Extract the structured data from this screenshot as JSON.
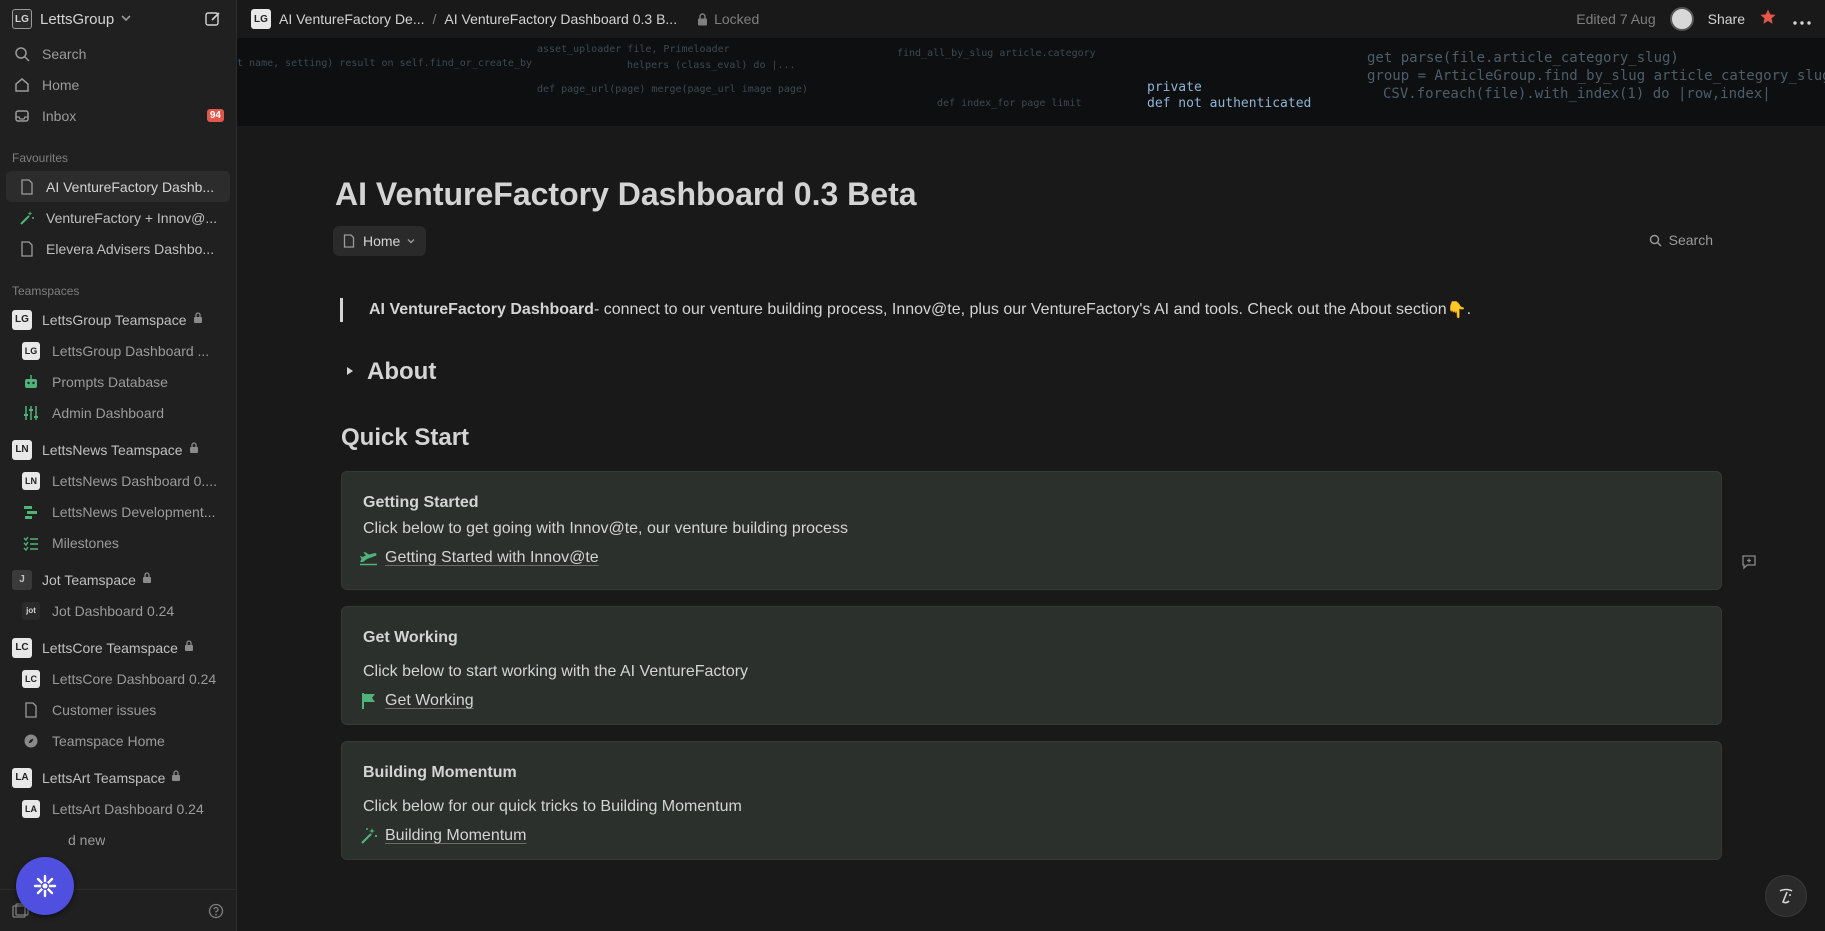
{
  "workspace": {
    "logo": "LG",
    "name": "LettsGroup"
  },
  "nav": {
    "search": "Search",
    "home": "Home",
    "inbox": "Inbox",
    "inbox_badge": "94"
  },
  "favourites": {
    "label": "Favourites",
    "items": [
      {
        "label": "AI VentureFactory Dashb..."
      },
      {
        "label": "VentureFactory + Innov@..."
      },
      {
        "label": "Elevera Advisers Dashbo..."
      }
    ]
  },
  "teamspaces": {
    "label": "Teamspaces",
    "groups": [
      {
        "logo": "LG",
        "name": "LettsGroup Teamspace",
        "children": [
          {
            "label": "LettsGroup Dashboard ..."
          },
          {
            "label": "Prompts Database"
          },
          {
            "label": "Admin Dashboard"
          }
        ]
      },
      {
        "logo": "LN",
        "name": "LettsNews Teamspace",
        "children": [
          {
            "label": "LettsNews Dashboard 0...."
          },
          {
            "label": "LettsNews Development..."
          },
          {
            "label": "Milestones"
          }
        ]
      },
      {
        "logo": "J",
        "name": "Jot Teamspace",
        "children": [
          {
            "label": "Jot Dashboard 0.24",
            "logo": "jot"
          }
        ]
      },
      {
        "logo": "LC",
        "name": "LettsCore Teamspace",
        "children": [
          {
            "label": "LettsCore Dashboard 0.24"
          },
          {
            "label": "Customer issues"
          },
          {
            "label": "Teamspace Home"
          }
        ]
      },
      {
        "logo": "LA",
        "name": "LettsArt Teamspace",
        "children": [
          {
            "label": "LettsArt Dashboard 0.24"
          }
        ]
      }
    ],
    "add_new": "d new"
  },
  "topbar": {
    "crumb_logo": "LG",
    "crumb_1": "AI VentureFactory De...",
    "crumb_sep": "/",
    "crumb_2": "AI VentureFactory Dashboard 0.3 B...",
    "locked": "Locked",
    "edited": "Edited 7 Aug",
    "share": "Share"
  },
  "cover": {
    "line1": "private",
    "line2": "def not authenticated",
    "line3": "get parse(file.article_category_slug)",
    "line4": "group = ArticleGroup.find_by_slug article_category_slug",
    "line5": "CSV.foreach(file).with_index(1) do |row,index|"
  },
  "page": {
    "title": "AI VentureFactory Dashboard 0.3 Beta",
    "home_chip": "Home",
    "search": "Search",
    "quote_bold": "AI VentureFactory Dashboard",
    "quote_text": " - connect to our venture building process, Innov@te, plus our VentureFactory's AI and tools. Check out the About section",
    "quote_emoji": "👇",
    "quote_end": ".",
    "about": "About",
    "quick_start": "Quick Start",
    "cards": [
      {
        "title": "Getting Started",
        "desc": "Click below to get going with Innov@te, our venture building process",
        "link": "Getting Started with Innov@te"
      },
      {
        "title": "Get Working",
        "desc": "Click below to start working with the AI VentureFactory",
        "link": "Get Working"
      },
      {
        "title": "Building Momentum",
        "desc": "Click below for our quick tricks to Building Momentum",
        "link": "Building Momentum"
      }
    ]
  },
  "colors": {
    "accent_green": "#4fb37a",
    "badge_red": "#e3574a",
    "fab_blue": "#4f4fe0",
    "card_bg": "#2b302c"
  }
}
